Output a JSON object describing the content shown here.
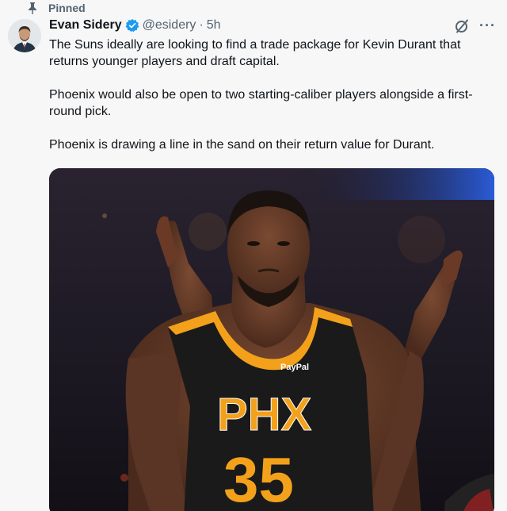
{
  "pinned_label": "Pinned",
  "author": {
    "name": "Evan Sidery",
    "handle": "@esidery",
    "separator": "·",
    "time": "5h"
  },
  "more_label": "···",
  "tweet_text": [
    "The Suns ideally are looking to find a trade package for Kevin Durant that returns younger players and draft capital.",
    "Phoenix would also be open to two starting-caliber players alongside a first-round pick.",
    "Phoenix is drawing a line in the sand on their return value for Durant."
  ],
  "media": {
    "jersey_text": "PHX",
    "jersey_number": "35",
    "sponsor": "PayPal"
  },
  "colors": {
    "verified_blue": "#1d9bf0",
    "secondary_text": "#536471",
    "jersey_black": "#1a1a1a",
    "jersey_orange": "#f3a11b"
  },
  "icons": [
    "pin-icon",
    "verified-badge-icon",
    "grok-icon",
    "more-icon"
  ]
}
